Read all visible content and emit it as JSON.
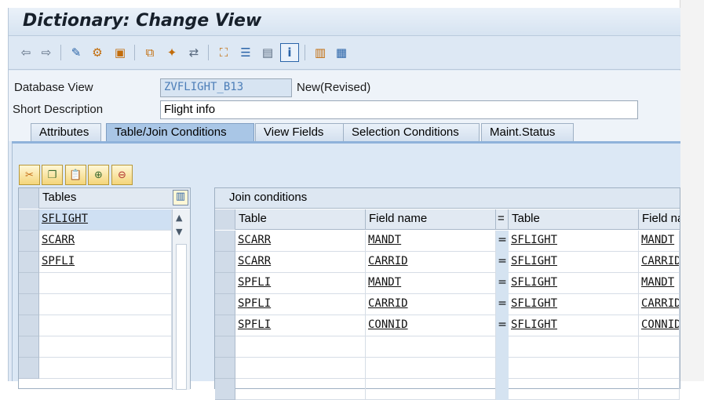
{
  "window": {
    "title": "Dictionary: Change View"
  },
  "toolbar": {
    "icons": [
      "back-icon",
      "forward-icon",
      "display-change-icon",
      "active-inactive-icon",
      "object-list-icon",
      "other-object-icon",
      "check-icon",
      "activate-icon",
      "where-used-icon",
      "hierarchy-icon",
      "view-icon",
      "info-icon",
      "layout-icon",
      "table-icon"
    ]
  },
  "form": {
    "db_view_label": "Database View",
    "db_view_value": "ZVFLIGHT_B13",
    "status": "New(Revised)",
    "short_desc_label": "Short Description",
    "short_desc_value": "Flight info"
  },
  "tabs": [
    {
      "label": "Attributes"
    },
    {
      "label": "Table/Join Conditions"
    },
    {
      "label": "View Fields"
    },
    {
      "label": "Selection Conditions"
    },
    {
      "label": "Maint.Status"
    }
  ],
  "tables_panel": {
    "header": "Tables",
    "rows": [
      "SFLIGHT",
      "SCARR",
      "SPFLI",
      "",
      "",
      "",
      "",
      ""
    ]
  },
  "join_panel": {
    "title": "Join conditions",
    "headers": {
      "table1": "Table",
      "field1": "Field name",
      "eq": "=",
      "table2": "Table",
      "field2": "Field na"
    },
    "rows": [
      {
        "t1": "SCARR",
        "f1": "MANDT",
        "eq": "=",
        "t2": "SFLIGHT",
        "f2": "MANDT"
      },
      {
        "t1": "SCARR",
        "f1": "CARRID",
        "eq": "=",
        "t2": "SFLIGHT",
        "f2": "CARRID"
      },
      {
        "t1": "SPFLI",
        "f1": "MANDT",
        "eq": "=",
        "t2": "SFLIGHT",
        "f2": "MANDT"
      },
      {
        "t1": "SPFLI",
        "f1": "CARRID",
        "eq": "=",
        "t2": "SFLIGHT",
        "f2": "CARRID"
      },
      {
        "t1": "SPFLI",
        "f1": "CONNID",
        "eq": "=",
        "t2": "SFLIGHT",
        "f2": "CONNID"
      }
    ]
  }
}
